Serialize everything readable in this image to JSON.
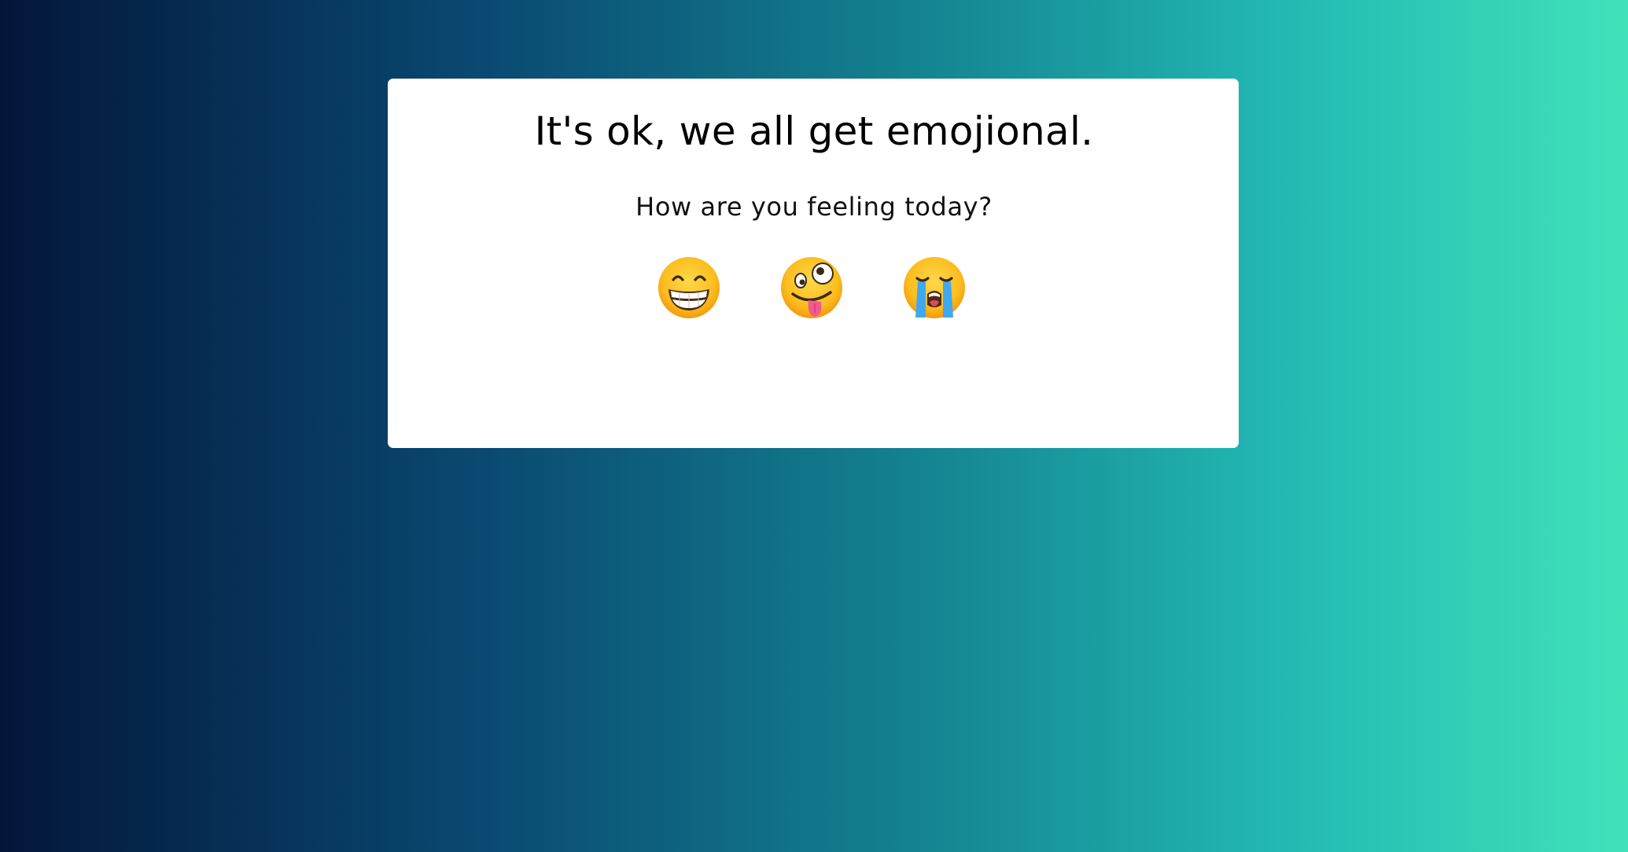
{
  "card": {
    "title": "It's ok, we all get emojional.",
    "subtitle": "How are you feeling today?"
  },
  "emojis": [
    {
      "icon": "grinning-face-with-smiling-eyes-icon"
    },
    {
      "icon": "zany-face-icon"
    },
    {
      "icon": "loudly-crying-face-icon"
    }
  ],
  "colors": {
    "gradient_start": "#03163a",
    "gradient_end": "#41e2ba",
    "card_background": "#ffffff",
    "text": "#000000"
  }
}
